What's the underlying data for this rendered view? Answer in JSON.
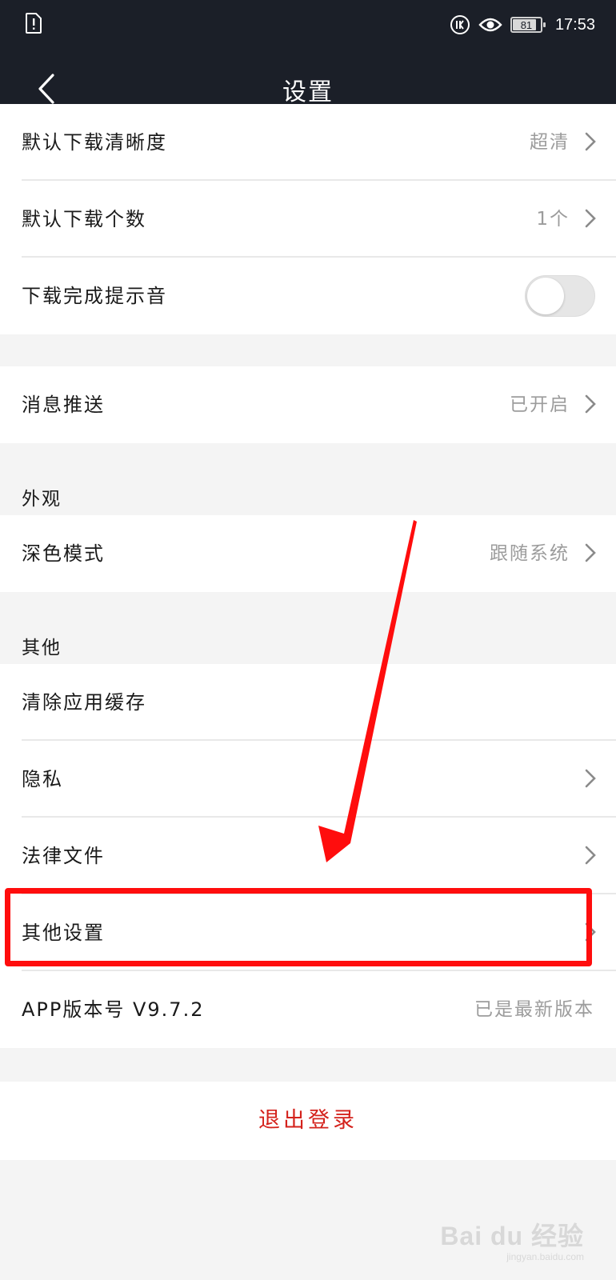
{
  "status_bar": {
    "battery": "81",
    "time": "17:53"
  },
  "nav": {
    "title": "设置"
  },
  "rows": [
    {
      "label": "默认下载清晰度",
      "value": "超清"
    },
    {
      "label": "默认下载个数",
      "value": "1个"
    },
    {
      "label": "下载完成提示音",
      "toggle": false
    },
    {
      "label": "消息推送",
      "value": "已开启"
    },
    {
      "label": "深色模式",
      "value": "跟随系统"
    },
    {
      "label": "清除应用缓存"
    },
    {
      "label": "隐私"
    },
    {
      "label": "法律文件"
    },
    {
      "label": "其他设置"
    },
    {
      "label": "APP版本号 V9.7.2",
      "value": "已是最新版本"
    }
  ],
  "sections": {
    "appearance": "外观",
    "other": "其他"
  },
  "logout_label": "退出登录",
  "watermark": {
    "brand": "Bai du 经验",
    "url": "jingyan.baidu.com"
  },
  "colors": {
    "header_bg": "#1b1f28",
    "logout_text": "#d4221c",
    "annotation": "#ff0d0d"
  }
}
